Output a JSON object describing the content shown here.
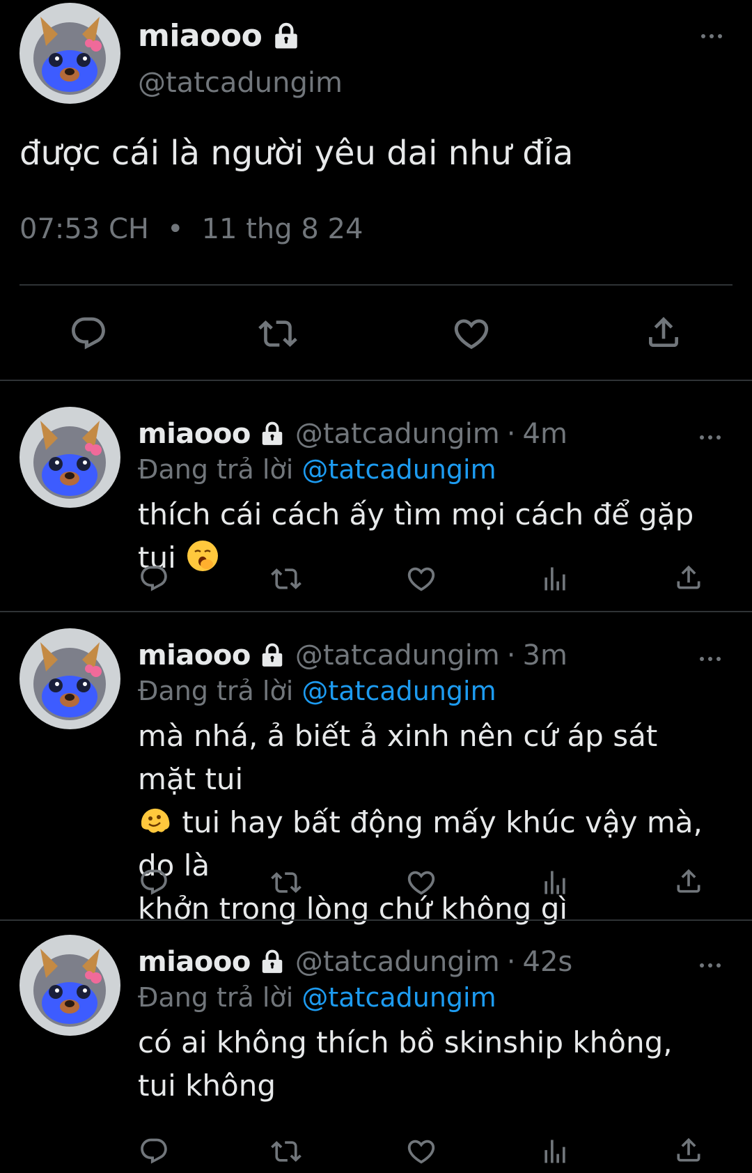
{
  "main_tweet": {
    "name": "miaooo",
    "handle": "@tatcadungim",
    "text": "được cái là người yêu dai như đỉa",
    "time": "07:53 CH",
    "dot": "•",
    "date": "11 thg 8 24"
  },
  "replies": [
    {
      "name": "miaooo",
      "handle": "@tatcadungim",
      "sep": "·",
      "time": "4m",
      "replying_prefix": "Đang trả lời",
      "replying_to": "@tatcadungim",
      "text": "thích cái cách ấy tìm mọi cách để gặp tui"
    },
    {
      "name": "miaooo",
      "handle": "@tatcadungim",
      "sep": "·",
      "time": "3m",
      "replying_prefix": "Đang trả lời",
      "replying_to": "@tatcadungim",
      "text_line1": "mà nhá, ả biết ả xinh nên cứ áp sát mặt tui",
      "text_line2": "tui hay bất động mấy khúc vậy mà, do là",
      "text_line3": "khởn trong lòng chứ không gì"
    },
    {
      "name": "miaooo",
      "handle": "@tatcadungim",
      "sep": "·",
      "time": "42s",
      "replying_prefix": "Đang trả lời",
      "replying_to": "@tatcadungim",
      "text": "có ai không thích bồ skinship không, tui không"
    }
  ],
  "colors": {
    "background": "#000000",
    "text": "#e7e9ea",
    "muted": "#71767b",
    "link": "#1d9bf0",
    "divider": "#2f3336"
  },
  "icons": [
    "lock-icon",
    "more-icon",
    "reply-icon",
    "retweet-icon",
    "like-icon",
    "views-icon",
    "share-icon",
    "yawning-face-emoji",
    "melting-face-emoji"
  ]
}
